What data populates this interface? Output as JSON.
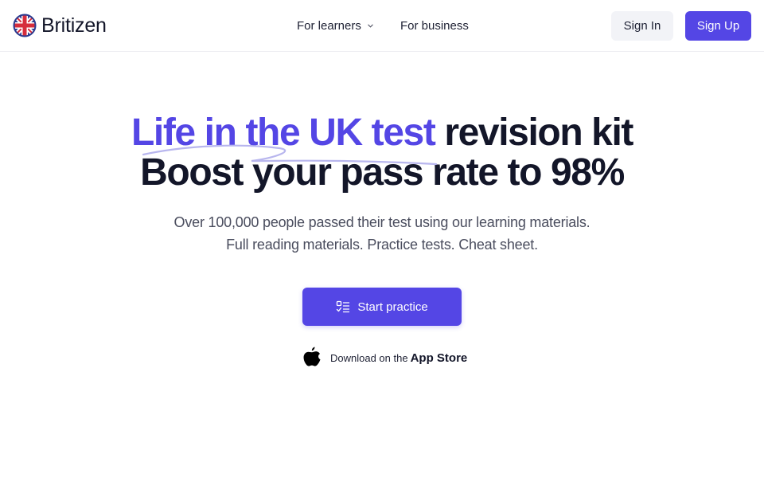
{
  "header": {
    "brand": "Britizen",
    "nav": {
      "learners": "For learners",
      "business": "For business"
    },
    "sign_in": "Sign In",
    "sign_up": "Sign Up"
  },
  "hero": {
    "title_highlight": "Life in the UK test",
    "title_rest": " revision kit",
    "title_line2": "Boost your pass rate to 98%",
    "subtitle_1": "Over 100,000 people passed their test using our learning materials.",
    "subtitle_2": "Full reading materials. Practice tests. Cheat sheet.",
    "cta": "Start practice",
    "appstore_pre": "Download on the",
    "appstore_name": "App Store"
  },
  "icons": {
    "logo": "uk-flag-icon",
    "nav_chevron": "chevron-down-icon",
    "cta": "checklist-icon",
    "appstore": "apple-icon"
  },
  "colors": {
    "accent": "#5446e5",
    "text": "#131629",
    "muted": "#4a4d5e",
    "secondary_button": "#f2f3f7"
  }
}
